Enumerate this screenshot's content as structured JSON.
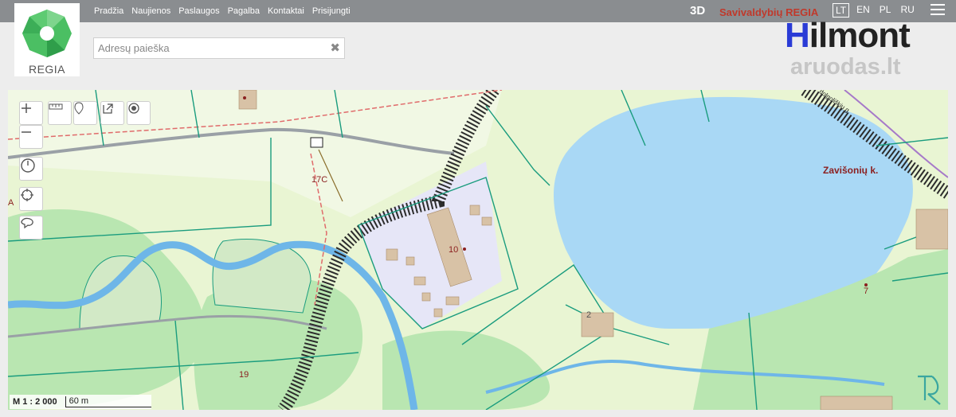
{
  "nav": {
    "items": [
      "Pradžia",
      "Naujienos",
      "Paslaugos",
      "Pagalba",
      "Kontaktai",
      "Prisijungti"
    ],
    "btn_3d": "3D",
    "municipality_label": "Savivaldybių REGIA",
    "languages": [
      "LT",
      "EN",
      "PL",
      "RU"
    ],
    "active_language": "LT"
  },
  "logo": {
    "text": "REGIA"
  },
  "search": {
    "placeholder": "Adresų paieška",
    "value": ""
  },
  "watermark": {
    "brand_h": "H",
    "brand_rest": "ilmont",
    "brand_sub": "aruodas.lt"
  },
  "map": {
    "scale_ratio": "M 1 : 2 000",
    "scale_bar": "60 m",
    "labels": [
      "17C",
      "10",
      "2",
      "7",
      "19",
      "Zavišonių k.",
      "A",
      "dolgoliškių g."
    ]
  },
  "colors": {
    "topbar": "#8a8d90",
    "lake": "#a9d8f5",
    "river": "#6eb6e8",
    "forest": "#b9e6b1",
    "parcel_line": "#1a9c7e",
    "road": "#2c2c2c",
    "accent_red": "#c0392b",
    "brand_blue": "#2a3bd6"
  },
  "icons": [
    "zoom-in-icon",
    "zoom-out-icon",
    "measure-icon",
    "marker-icon",
    "export-icon",
    "locate-icon",
    "history-icon",
    "crosshair-icon",
    "draw-area-icon",
    "menu-icon",
    "clear-icon"
  ]
}
